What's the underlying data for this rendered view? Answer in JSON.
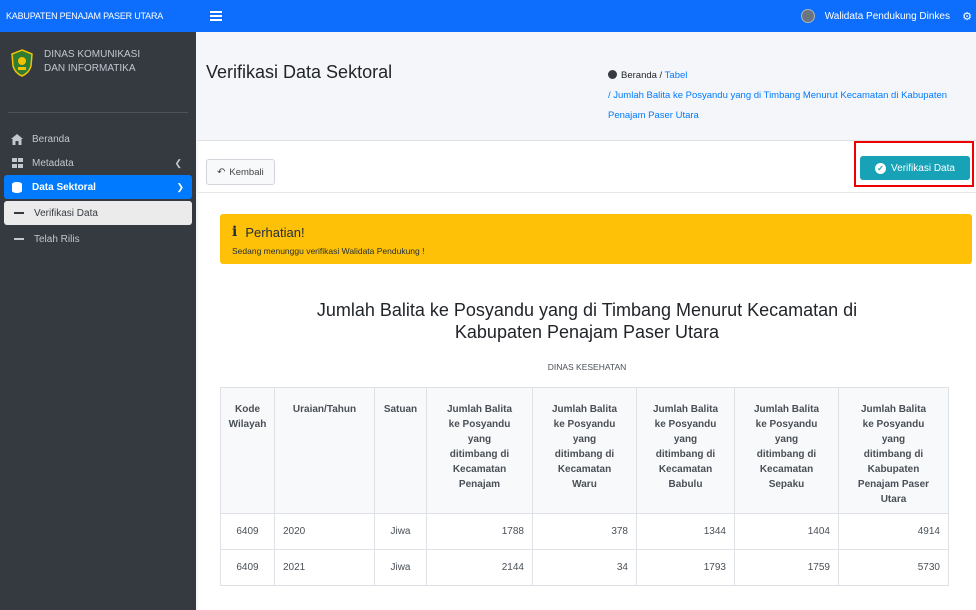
{
  "sidebar": {
    "brand": "KABUPATEN PENAJAM PASER UTARA",
    "org_name_line1": "DINAS KOMUNIKASI",
    "org_name_line2": "DAN INFORMATIKA",
    "menu": {
      "beranda": "Beranda",
      "metadata": "Metadata",
      "data_sektoral": "Data Sektoral",
      "verifikasi_data": "Verifikasi Data",
      "telah_rilis": "Telah Rilis"
    }
  },
  "topbar": {
    "user_name": "Walidata Pendukung Dinkes"
  },
  "header": {
    "page_title": "Verifikasi Data Sektoral",
    "breadcrumb": {
      "home": "Beranda",
      "sep1": " / ",
      "tabel": "Tabel",
      "current": "/ Jumlah Balita ke Posyandu yang di Timbang Menurut Kecamatan di Kabupaten Penajam Paser Utara"
    }
  },
  "card": {
    "back_label": "Kembali",
    "verify_label": "Verifikasi Data",
    "alert_title": "Perhatian!",
    "alert_message": "Sedang menunggu verifikasi Walidata Pendukung !",
    "table_title_line1": "Jumlah Balita ke Posyandu yang di Timbang Menurut Kecamatan di",
    "table_title_line2": "Kabupaten Penajam Paser Utara",
    "table_subtitle": "DINAS KESEHATAN"
  },
  "table": {
    "headers": [
      [
        "Kode",
        "Wilayah"
      ],
      [
        "Uraian/Tahun"
      ],
      [
        "Satuan"
      ],
      [
        "Jumlah Balita",
        "ke Posyandu",
        "yang",
        "ditimbang di",
        "Kecamatan",
        "Penajam"
      ],
      [
        "Jumlah Balita",
        "ke Posyandu",
        "yang",
        "ditimbang di",
        "Kecamatan",
        "Waru"
      ],
      [
        "Jumlah Balita",
        "ke Posyandu",
        "yang",
        "ditimbang di",
        "Kecamatan",
        "Babulu"
      ],
      [
        "Jumlah Balita",
        "ke Posyandu",
        "yang",
        "ditimbang di",
        "Kecamatan",
        "Sepaku"
      ],
      [
        "Jumlah Balita",
        "ke Posyandu",
        "yang",
        "ditimbang di",
        "Kabupaten",
        "Penajam Paser",
        "Utara"
      ]
    ],
    "rows": [
      [
        "6409",
        "2020",
        "Jiwa",
        "1788",
        "378",
        "1344",
        "1404",
        "4914"
      ],
      [
        "6409",
        "2021",
        "Jiwa",
        "2144",
        "34",
        "1793",
        "1759",
        "5730"
      ]
    ]
  },
  "colors": {
    "topbar": "#0d6efd",
    "sidebar": "#343a40",
    "verify_button": "#17a2b8",
    "alert": "#ffc107",
    "highlight_box": "#ee0000"
  }
}
